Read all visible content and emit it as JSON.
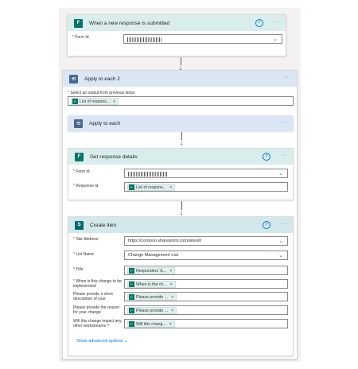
{
  "trigger": {
    "title": "When a new response is submitted",
    "form_id_label": "Form Id"
  },
  "apply_outer": {
    "title": "Apply to each 2",
    "select_label": "Select an output from previous steps",
    "token": "List of respons..."
  },
  "apply_inner": {
    "title": "Apply to each"
  },
  "get_details": {
    "title": "Get response details",
    "form_id_label": "Form Id",
    "response_id_label": "Response Id",
    "response_token": "List of respons..."
  },
  "create_item": {
    "title": "Create item",
    "fields": [
      {
        "label": "Site Address",
        "required": true,
        "kind": "dropdown",
        "value": "https://contoso.sharepoint.com/sites/it"
      },
      {
        "label": "List Name",
        "required": true,
        "kind": "dropdown",
        "value": "Change Management List"
      },
      {
        "label": "Title",
        "required": true,
        "kind": "token",
        "value": "Responders' E..."
      },
      {
        "label": "When is this change to be implemented",
        "required": true,
        "kind": "token",
        "value": "When is the ch..."
      },
      {
        "label": "Please provide a short description of your",
        "required": false,
        "kind": "token",
        "value": "Please provide ..."
      },
      {
        "label": "Please provide the reason for your change",
        "required": false,
        "kind": "token",
        "value": "Please provide ..."
      },
      {
        "label": "Will this change impact any other workstreams ?",
        "required": false,
        "kind": "token",
        "value": "Will this chang..."
      }
    ],
    "advanced_label": "Show advanced options"
  },
  "icons": {
    "forms": "forms-icon",
    "loop": "loop-icon",
    "sharepoint": "sharepoint-icon",
    "help": "help-icon",
    "more": "more-icon"
  },
  "colors": {
    "accent": "#0078d4",
    "forms": "#077568",
    "loop": "#486991",
    "sharepoint": "#036c70",
    "required": "#a4262c"
  }
}
